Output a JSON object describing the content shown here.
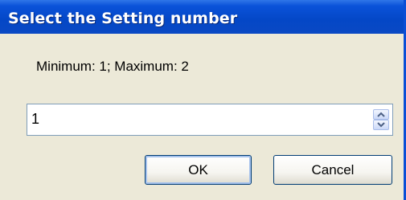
{
  "dialog": {
    "title": "Select the Setting number",
    "prompt": "Minimum: 1; Maximum: 2",
    "spin_value": "1",
    "ok_label": "OK",
    "cancel_label": "Cancel"
  },
  "icons": {
    "spin_up": "chevron-up-icon",
    "spin_down": "chevron-down-icon"
  },
  "colors": {
    "titlebar": "#0447c6",
    "dialog_bg": "#ece9d8",
    "field_border": "#7f9db9",
    "button_border": "#003c74"
  }
}
